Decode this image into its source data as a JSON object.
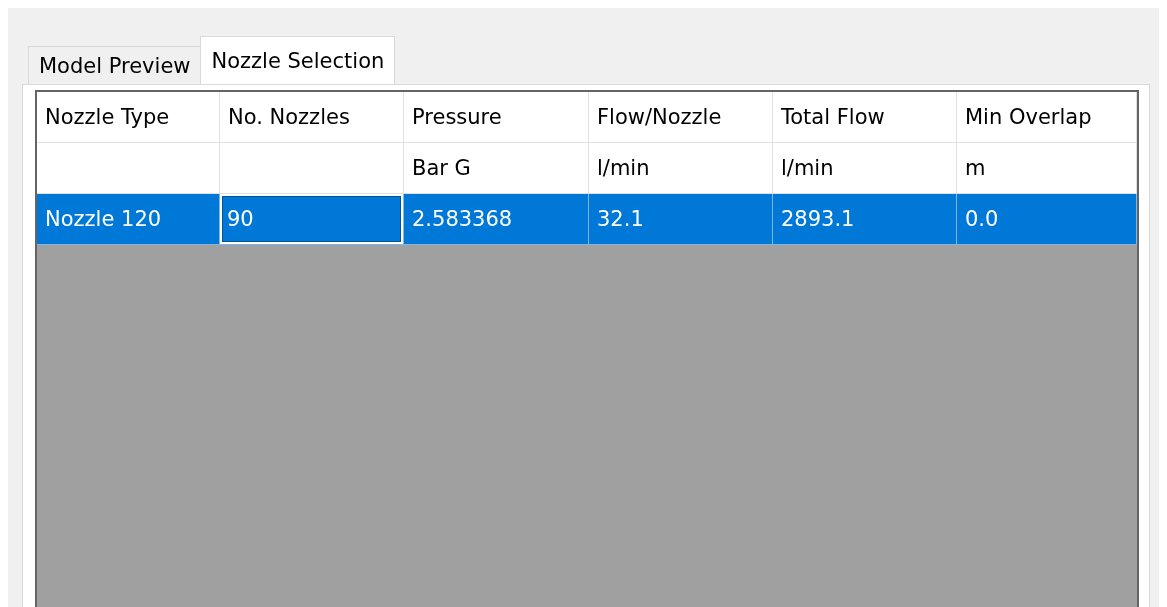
{
  "tabs": [
    {
      "label": "Model Preview",
      "selected": false
    },
    {
      "label": "Nozzle Selection",
      "selected": true
    }
  ],
  "table": {
    "columns": [
      {
        "heading": "Nozzle Type"
      },
      {
        "heading": "No. Nozzles"
      },
      {
        "heading": "Pressure",
        "unit": "Bar G"
      },
      {
        "heading": "Flow/Nozzle",
        "unit": "l/min"
      },
      {
        "heading": "Total Flow",
        "unit": "l/min"
      },
      {
        "heading": "Min Overlap",
        "unit": "m"
      }
    ],
    "rows": [
      {
        "selected": true,
        "cells": [
          {
            "text": "Nozzle 120",
            "editing": false
          },
          {
            "text": "90",
            "editing": true
          },
          {
            "text": "2.583368",
            "editing": false
          },
          {
            "text": "32.1",
            "editing": false
          },
          {
            "text": "2893.1",
            "editing": false
          },
          {
            "text": "0.0",
            "editing": false
          }
        ]
      }
    ]
  }
}
